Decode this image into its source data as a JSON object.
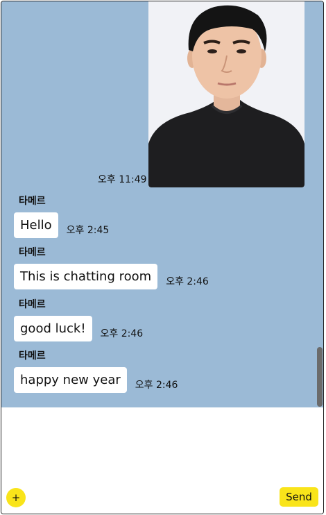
{
  "chat": {
    "my_message": {
      "type": "image",
      "time": "오후 11:49"
    },
    "messages": [
      {
        "sender": "타메르",
        "text": "Hello",
        "time": "오후 2:45"
      },
      {
        "sender": "타메르",
        "text": "This is chatting room",
        "time": "오후 2:46"
      },
      {
        "sender": "타메르",
        "text": "good luck!",
        "time": "오후 2:46"
      },
      {
        "sender": "타메르",
        "text": "happy new year",
        "time": "오후 2:46"
      }
    ]
  },
  "composer": {
    "plus_label": "+",
    "send_label": "Send"
  },
  "colors": {
    "chat_background": "#9bbad6",
    "accent_yellow": "#f9e41a",
    "bubble": "#ffffff"
  }
}
